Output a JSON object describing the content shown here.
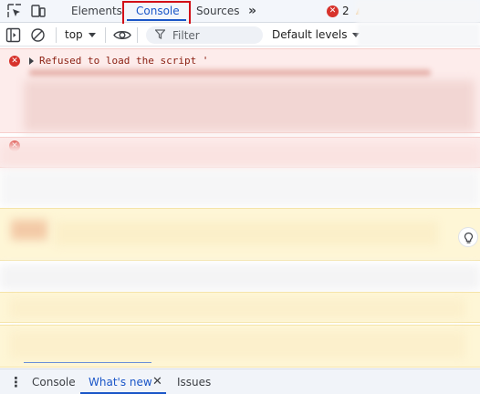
{
  "tabbar": {
    "tabs": [
      {
        "label": "Elements"
      },
      {
        "label": "Console"
      },
      {
        "label": "Sources"
      }
    ],
    "more_glyph": "»",
    "error_count": "2",
    "icons": [
      "inspect-element-icon",
      "device-toolbar-icon",
      "more-tabs-icon",
      "error-icon",
      "warning-icon"
    ]
  },
  "toolbar": {
    "context": "top",
    "filter_placeholder": "Filter",
    "levels": "Default levels",
    "icons": [
      "sidebar-toggle-icon",
      "clear-console-icon",
      "chevron-down-icon",
      "eye-icon",
      "filter-icon"
    ]
  },
  "console": {
    "messages": [
      {
        "level": "error",
        "text": "Refused to load the script '"
      }
    ]
  },
  "drawer": {
    "menu_glyph": "⋮",
    "tabs": [
      {
        "label": "Console"
      },
      {
        "label": "What's new"
      },
      {
        "label": "Issues"
      }
    ],
    "close_glyph": "✕"
  },
  "colors": {
    "accent": "#1a56c8",
    "highlight_border": "#d20f17",
    "error": "#d7332c",
    "error_bg": "#fdeceb",
    "warning_bg": "#fef6d6"
  }
}
